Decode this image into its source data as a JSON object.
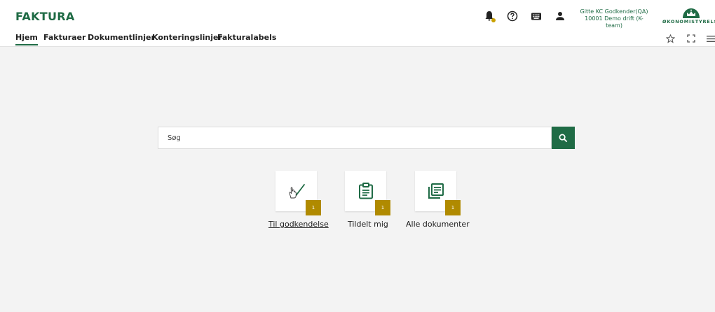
{
  "app": {
    "title": "FAKTURA"
  },
  "user": {
    "name": "Gitte KC Godkender(QA)",
    "org": "10001 Demo drift (K-team)"
  },
  "logo": {
    "text": "ØKONOMISTYRELSEN"
  },
  "nav": {
    "tabs": [
      {
        "label": "Hjem",
        "active": true
      },
      {
        "label": "Fakturaer",
        "active": false
      },
      {
        "label": "Dokumentlinjer",
        "active": false
      },
      {
        "label": "Konteringslinjer",
        "active": false
      },
      {
        "label": "Fakturalabels",
        "active": false
      }
    ]
  },
  "search": {
    "placeholder": "Søg",
    "value": ""
  },
  "tiles": [
    {
      "label": "Til godkendelse",
      "count": "1",
      "icon": "approve-hand-icon"
    },
    {
      "label": "Tildelt mig",
      "count": "1",
      "icon": "clipboard-icon"
    },
    {
      "label": "Alle dokumenter",
      "count": "1",
      "icon": "documents-icon"
    }
  ],
  "colors": {
    "brand": "#1f6b45",
    "badge": "#b08a00",
    "background": "#f3f3f3"
  },
  "icons": {
    "topbar": [
      "bell-icon",
      "help-icon",
      "keyboard-icon",
      "user-icon"
    ],
    "navbar": [
      "star-icon",
      "fullscreen-icon",
      "menu-icon"
    ]
  }
}
